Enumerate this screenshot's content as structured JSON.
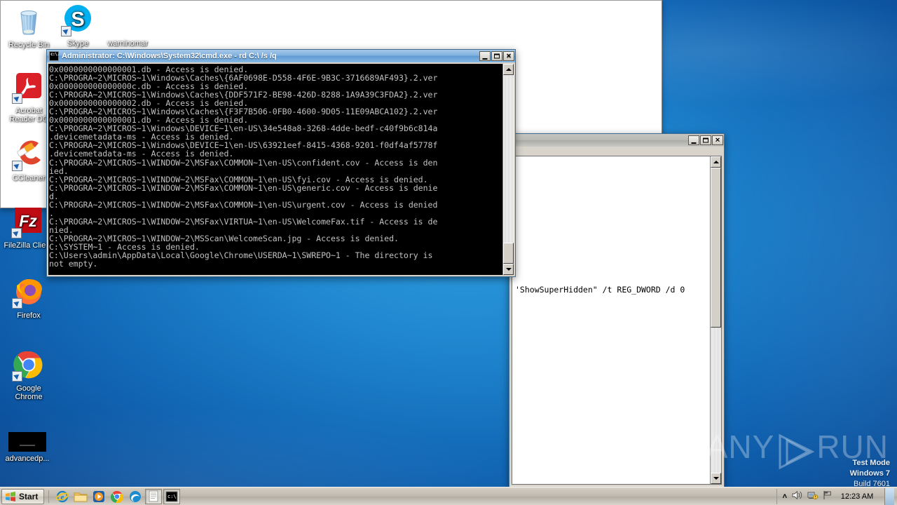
{
  "desktop": {
    "icons": [
      {
        "name": "recycle-bin",
        "label": "Recycle Bin",
        "shortcut": false
      },
      {
        "name": "skype",
        "label": "Skype",
        "shortcut": true
      },
      {
        "name": "warninomar",
        "label": "warninomar",
        "shortcut": false
      },
      {
        "name": "acrobat-reader-dc",
        "label": "Acrobat\nReader DC",
        "shortcut": true
      },
      {
        "name": "ccleaner",
        "label": "CCleaner",
        "shortcut": true
      },
      {
        "name": "filezilla-client",
        "label": "FileZilla Client",
        "shortcut": true
      },
      {
        "name": "firefox",
        "label": "Firefox",
        "shortcut": true
      },
      {
        "name": "google-chrome",
        "label": "Google\nChrome",
        "shortcut": true
      },
      {
        "name": "advancedp",
        "label": "advancedp...",
        "shortcut": false
      }
    ]
  },
  "cmd_window": {
    "title": "Administrator: C:\\Windows\\System32\\cmd.exe - rd C:\\ /s /q",
    "buttons": {
      "minimize": "_",
      "maximize": "□",
      "close": "✕"
    },
    "console_lines": [
      "0x0000000000000001.db - Access is denied.",
      "C:\\PROGRA~2\\MICROS~1\\Windows\\Caches\\{6AF0698E-D558-4F6E-9B3C-3716689AF493}.2.ver",
      "0x000000000000000c.db - Access is denied.",
      "C:\\PROGRA~2\\MICROS~1\\Windows\\Caches\\{DDF571F2-BE98-426D-8288-1A9A39C3FDA2}.2.ver",
      "0x0000000000000002.db - Access is denied.",
      "C:\\PROGRA~2\\MICROS~1\\Windows\\Caches\\{F3F7B506-0FB0-4600-9D05-11E09ABCA102}.2.ver",
      "0x0000000000000001.db - Access is denied.",
      "C:\\PROGRA~2\\MICROS~1\\Windows\\DEVICE~1\\en-US\\34e548a8-3268-4dde-bedf-c40f9b6c814a",
      ".devicemetadata-ms - Access is denied.",
      "C:\\PROGRA~2\\MICROS~1\\Windows\\DEVICE~1\\en-US\\63921eef-8415-4368-9201-f0df4af5778f",
      ".devicemetadata-ms - Access is denied.",
      "C:\\PROGRA~2\\MICROS~1\\WINDOW~2\\MSFax\\COMMON~1\\en-US\\confident.cov - Access is den",
      "ied.",
      "C:\\PROGRA~2\\MICROS~1\\WINDOW~2\\MSFax\\COMMON~1\\en-US\\fyi.cov - Access is denied.",
      "C:\\PROGRA~2\\MICROS~1\\WINDOW~2\\MSFax\\COMMON~1\\en-US\\generic.cov - Access is denie",
      "d.",
      "C:\\PROGRA~2\\MICROS~1\\WINDOW~2\\MSFax\\COMMON~1\\en-US\\urgent.cov - Access is denied",
      ".",
      "C:\\PROGRA~2\\MICROS~1\\WINDOW~2\\MSFax\\VIRTUA~1\\en-US\\WelcomeFax.tif - Access is de",
      "nied.",
      "C:\\PROGRA~2\\MICROS~1\\WINDOW~2\\MSScan\\WelcomeScan.jpg - Access is denied.",
      "C:\\SYSTEM~1 - Access is denied.",
      "C:\\Users\\admin\\AppData\\Local\\Google\\Chrome\\USERDA~1\\SWREPO~1 - The directory is",
      "not empty."
    ]
  },
  "background_window": {
    "title": "",
    "buttons": {
      "minimize": "_",
      "maximize": "□",
      "close": "✕"
    },
    "text": "'ShowSuperHidden\" /t REG_DWORD /d 0"
  },
  "white_window": {
    "title": ""
  },
  "watermark": {
    "brand_left": "ANY",
    "brand_right": "RUN",
    "test_mode": "Test Mode",
    "os": "Windows 7",
    "build": "Build 7601"
  },
  "taskbar": {
    "start_label": "Start",
    "quick_launch": [
      {
        "name": "internet-explorer-icon",
        "label": "Internet Explorer"
      },
      {
        "name": "windows-explorer-icon",
        "label": "Windows Explorer"
      },
      {
        "name": "media-player-icon",
        "label": "Windows Media Player"
      },
      {
        "name": "google-chrome-icon",
        "label": "Google Chrome"
      },
      {
        "name": "edge-icon",
        "label": "Microsoft Edge"
      },
      {
        "name": "notepad-icon",
        "label": "Notepad"
      },
      {
        "name": "cmd-icon",
        "label": "cmd.exe"
      }
    ],
    "tray": {
      "show_hidden": "˄",
      "volume": "volume-icon",
      "network": "network-icon",
      "action_center": "flag-icon",
      "clock": "12:23 AM"
    }
  },
  "colors": {
    "desktop_blue": "#1268b6",
    "console_bg": "#000000",
    "console_fg": "#c0c0c0",
    "title_active": "#5f9ad3",
    "title_inactive": "#b9b9b6",
    "chrome_face": "#d4d0c8"
  }
}
